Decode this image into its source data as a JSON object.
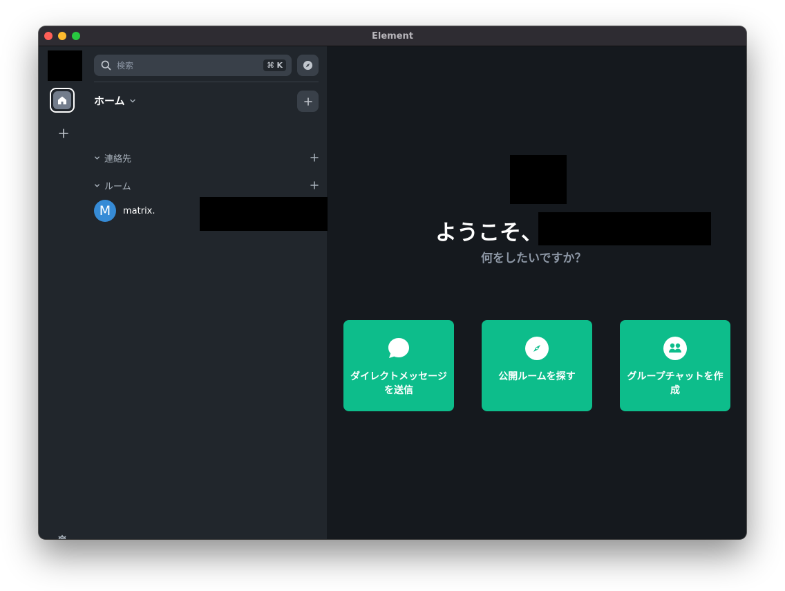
{
  "window": {
    "title": "Element"
  },
  "spacebar": {
    "home_icon": "home-icon",
    "add_icon": "plus-icon",
    "settings_icon": "gear-icon"
  },
  "roomlist": {
    "search": {
      "placeholder": "検索",
      "shortcut": "⌘ K"
    },
    "home_label": "ホーム",
    "sections": [
      {
        "label": "連絡先"
      },
      {
        "label": "ルーム"
      }
    ],
    "rooms": [
      {
        "initial": "M",
        "name": "matrix."
      }
    ]
  },
  "main": {
    "welcome": "ようこそ、",
    "subtitle": "何をしたいですか？",
    "actions": [
      {
        "label": "ダイレクトメッセージを送信",
        "icon": "chat-bubble-icon"
      },
      {
        "label": "公開ルームを探す",
        "icon": "compass-icon"
      },
      {
        "label": "グループチャットを作成",
        "icon": "group-icon"
      }
    ]
  },
  "colors": {
    "accent": "#0dbd8b",
    "panel": "#21262c",
    "main_bg": "#15191e",
    "avatar": "#368bd6"
  }
}
